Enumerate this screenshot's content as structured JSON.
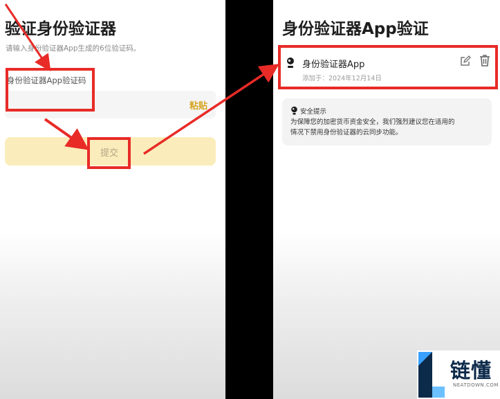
{
  "left": {
    "title": "验证身份验证器",
    "subtitle": "请输入身份验证器App生成的6位验证码。",
    "field_label": "身份验证器App验证码",
    "input_value": "",
    "input_placeholder": "",
    "paste_label": "粘贴",
    "submit_label": "提交"
  },
  "right": {
    "title": "身份验证器App验证",
    "card": {
      "name": "身份验证器App",
      "added_date": "添加于：2024年12月14日"
    },
    "tip": {
      "title": "安全提示",
      "body_line1": "为保障您的加密货币资金安全，我们强烈建议您在适用的",
      "body_line2": "情况下禁用身份验证器的云同步功能。"
    }
  },
  "icons": {
    "avatar": "authenticator-avatar-icon",
    "edit": "edit-icon",
    "delete": "trash-icon",
    "tip": "lightbulb-icon"
  },
  "colors": {
    "annotation": "#e82b27",
    "paste": "#d6a421",
    "submit_bg": "#fbedbb"
  },
  "watermark": {
    "brand_cn": "链懂",
    "brand_en": "NEATDOWN.COM"
  }
}
